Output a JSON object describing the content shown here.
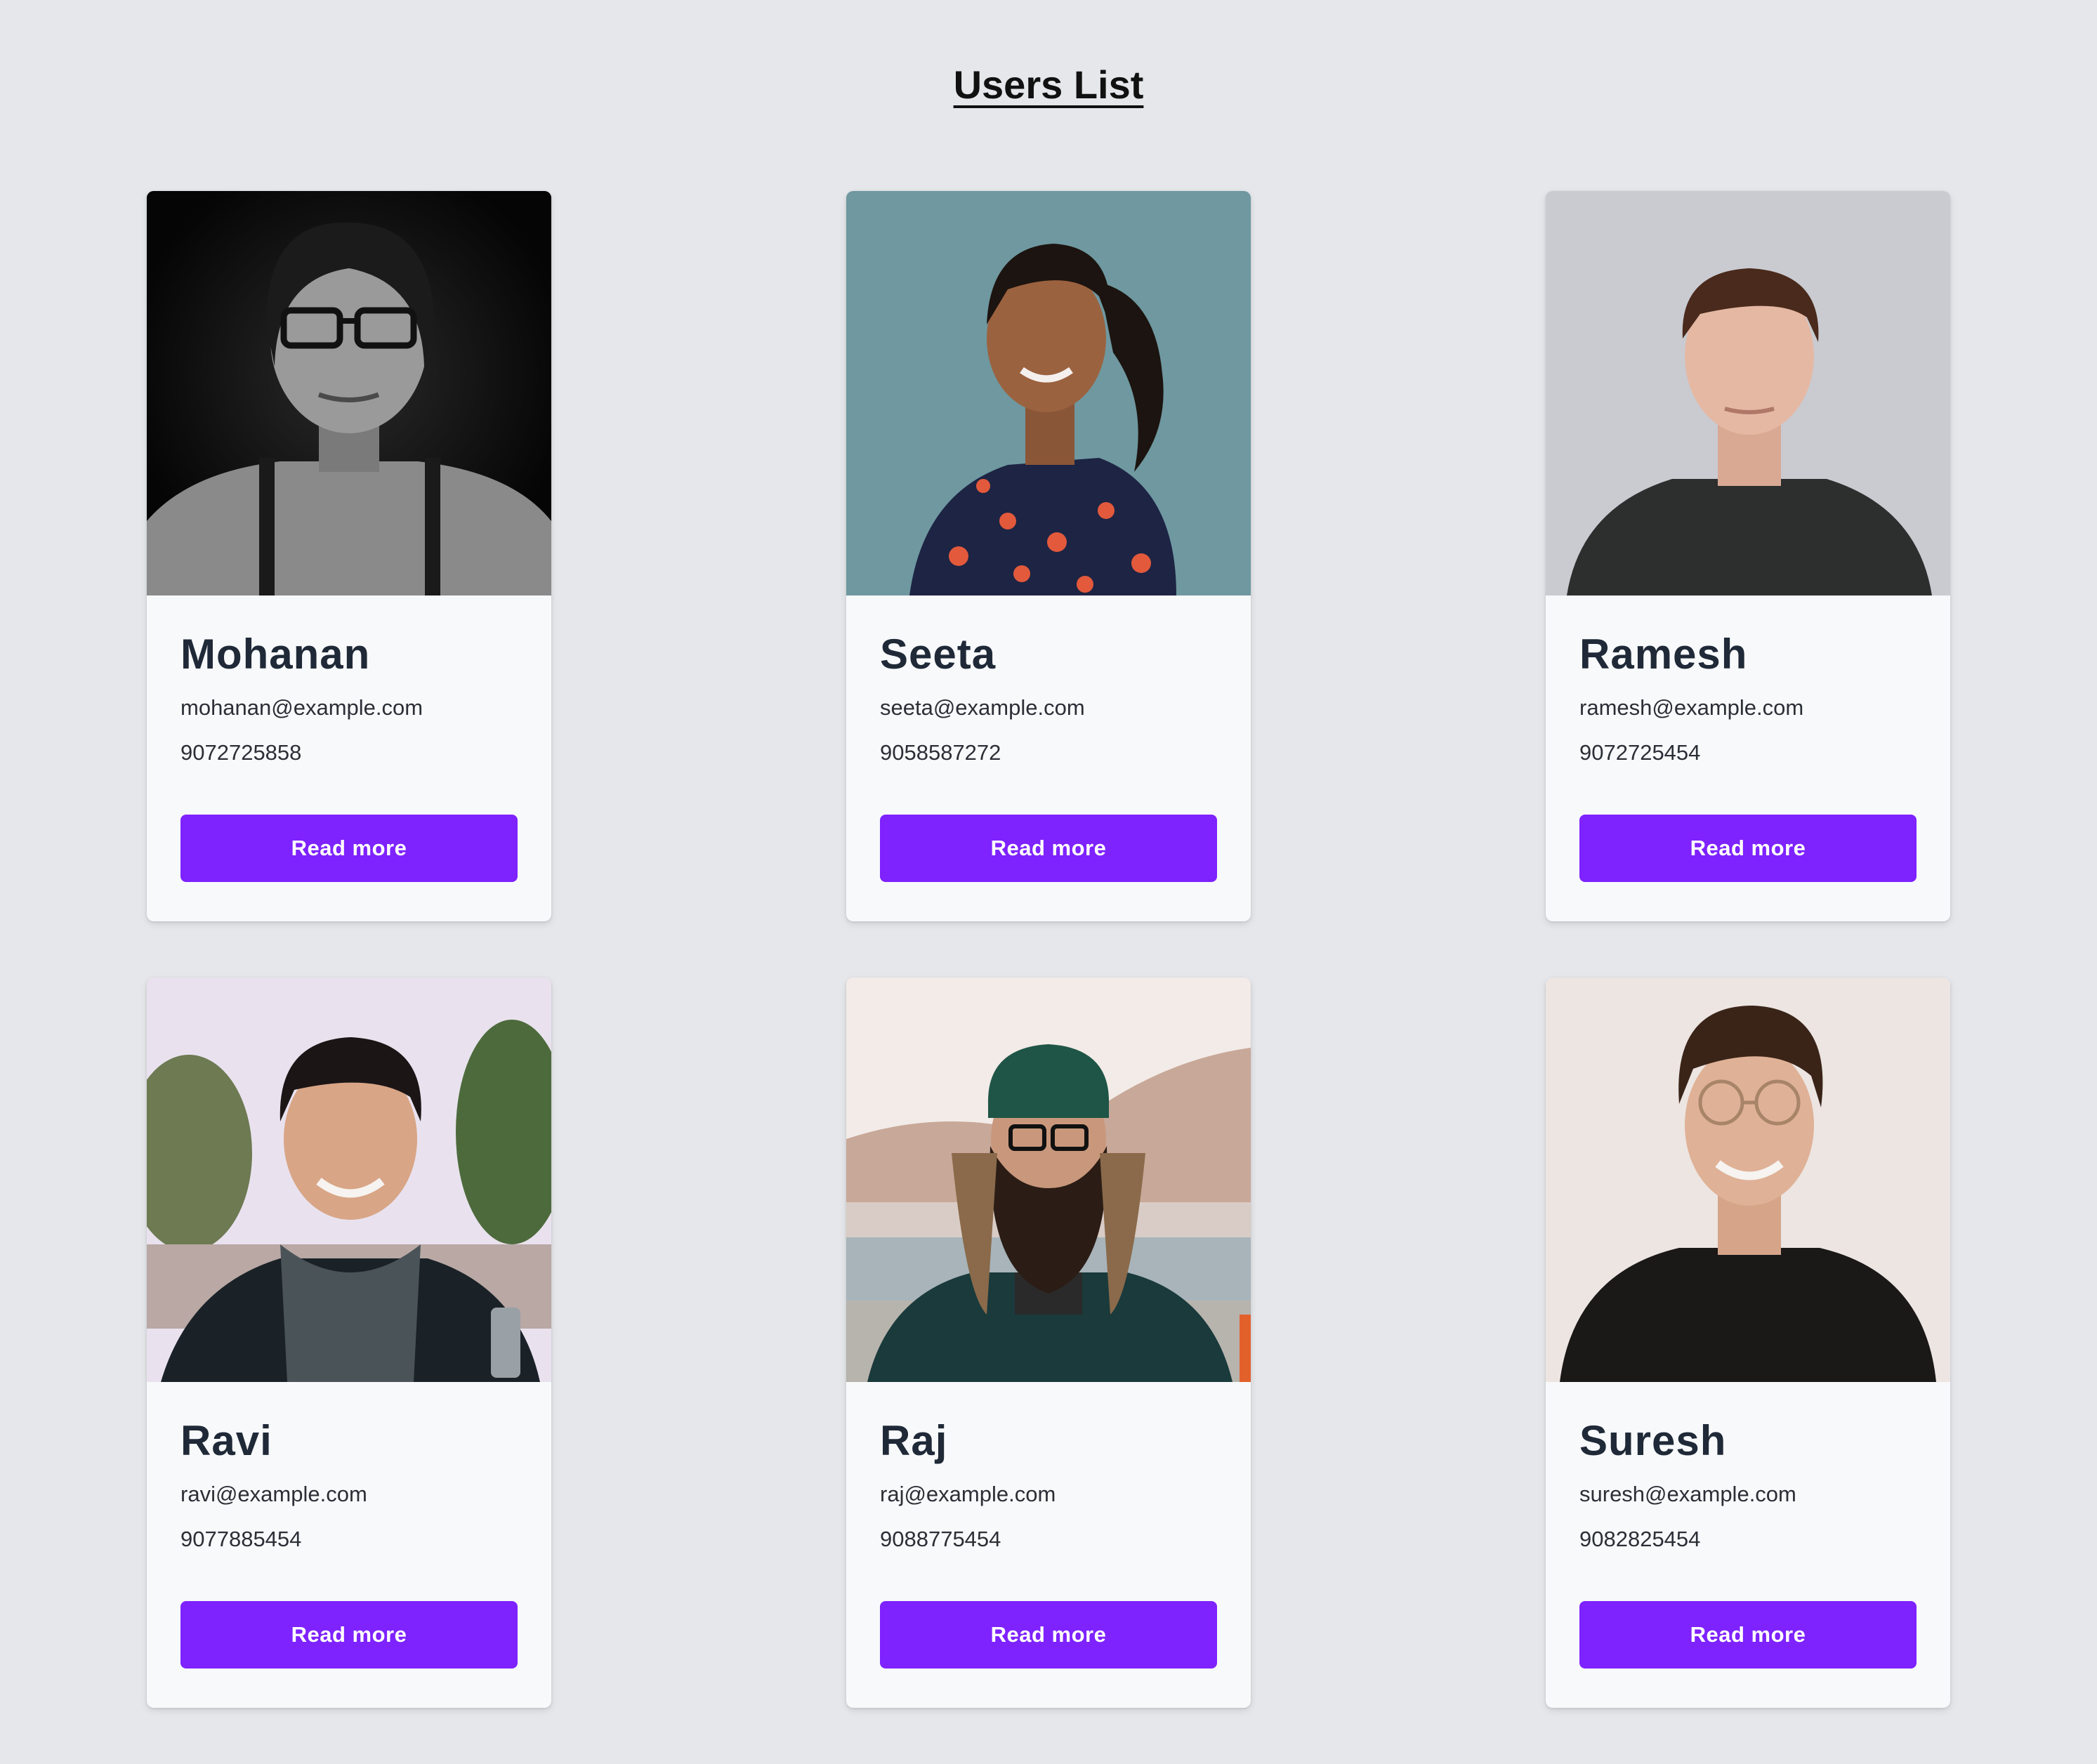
{
  "page": {
    "title": "Users List"
  },
  "theme": {
    "background": "#e5e7eb",
    "card": "#f8f9fb",
    "accent": "#7e22fe",
    "text": "#1f2937"
  },
  "users": [
    {
      "name": "Mohanan",
      "email": "mohanan@example.com",
      "phone": "9072725858",
      "button_label": "Read more",
      "photo": "portrait-photo"
    },
    {
      "name": "Seeta",
      "email": "seeta@example.com",
      "phone": "9058587272",
      "button_label": "Read more",
      "photo": "portrait-photo"
    },
    {
      "name": "Ramesh",
      "email": "ramesh@example.com",
      "phone": "9072725454",
      "button_label": "Read more",
      "photo": "portrait-photo"
    },
    {
      "name": "Ravi",
      "email": "ravi@example.com",
      "phone": "9077885454",
      "button_label": "Read more",
      "photo": "portrait-photo"
    },
    {
      "name": "Raj",
      "email": "raj@example.com",
      "phone": "9088775454",
      "button_label": "Read more",
      "photo": "portrait-photo"
    },
    {
      "name": "Suresh",
      "email": "suresh@example.com",
      "phone": "9082825454",
      "button_label": "Read more",
      "photo": "portrait-photo"
    }
  ]
}
